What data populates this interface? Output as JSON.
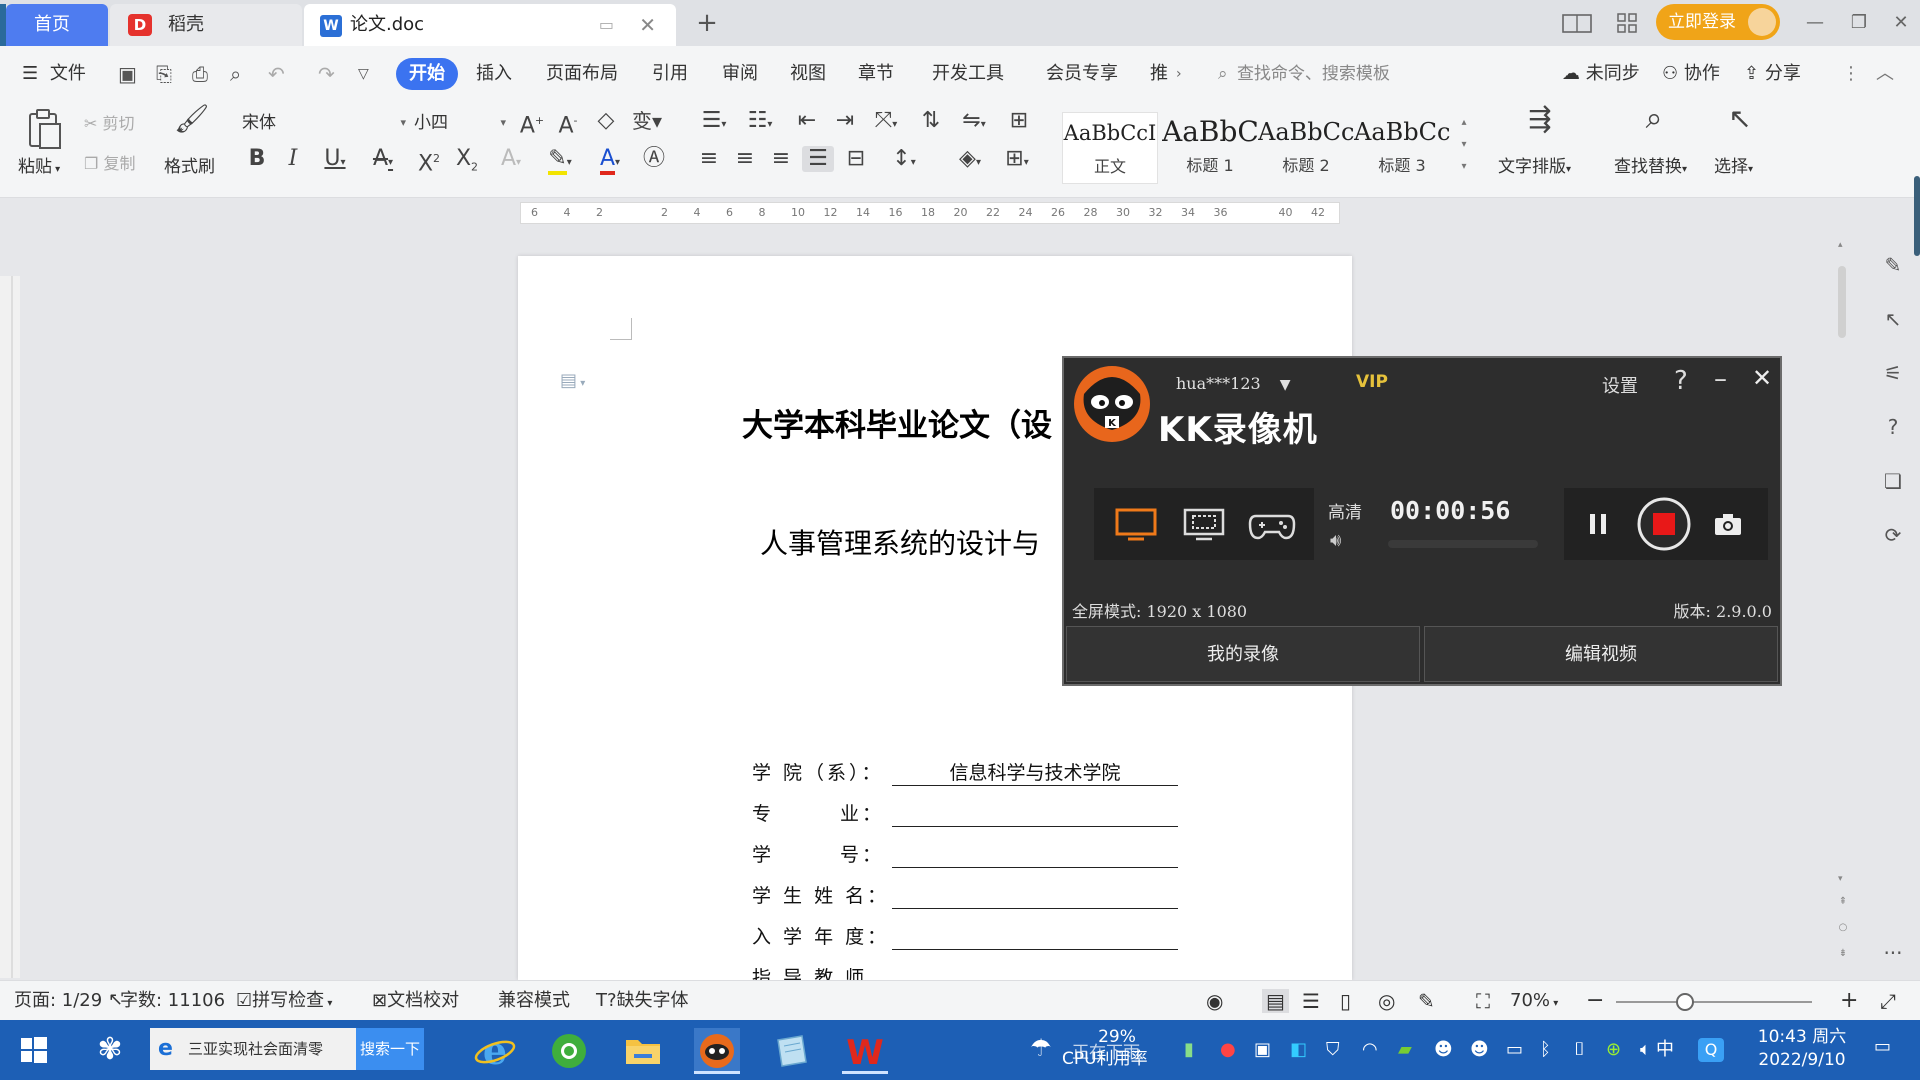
{
  "tabs": {
    "home": "首页",
    "daoke": "稻壳",
    "doc": "论文.doc"
  },
  "header": {
    "login": "立即登录"
  },
  "menu": {
    "file": "文件",
    "items": [
      "开始",
      "插入",
      "页面布局",
      "引用",
      "审阅",
      "视图",
      "章节",
      "开发工具",
      "会员专享",
      "推"
    ],
    "search_placeholder": "查找命令、搜索模板",
    "unsynced": "未同步",
    "collab": "协作",
    "share": "分享"
  },
  "ribbon": {
    "paste": "粘贴",
    "cut": "剪切",
    "copy": "复制",
    "format_painter": "格式刷",
    "font_name": "宋体",
    "font_size": "小四",
    "styles": [
      {
        "preview": "AaBbCcI",
        "label": "正文"
      },
      {
        "preview": "AaBbC",
        "label": "标题 1"
      },
      {
        "preview": "AaBbCc",
        "label": "标题 2"
      },
      {
        "preview": "AaBbCc",
        "label": "标题 3"
      }
    ],
    "text_layout": "文字排版",
    "find_replace": "查找替换",
    "select": "选择"
  },
  "ruler": {
    "ticks": [
      "6",
      "4",
      "2",
      "",
      "2",
      "4",
      "6",
      "8",
      "10",
      "12",
      "14",
      "16",
      "18",
      "20",
      "22",
      "24",
      "26",
      "28",
      "30",
      "32",
      "34",
      "36",
      "",
      "40",
      "42"
    ]
  },
  "document": {
    "title": "大学本科毕业论文（设",
    "subtitle": "人事管理系统的设计与",
    "form": [
      {
        "label": "学 院（系）：",
        "value": "信息科学与技术学院"
      },
      {
        "label": "专　　　业：",
        "value": ""
      },
      {
        "label": "学　　　号：",
        "value": ""
      },
      {
        "label": "学 生 姓 名：",
        "value": ""
      },
      {
        "label": "入 学 年 度：",
        "value": ""
      },
      {
        "label": "指 导 教 师",
        "value": ""
      }
    ]
  },
  "status": {
    "page": "页面: 1/29",
    "words": "字数: 11106",
    "spell": "拼写检查",
    "proof": "文档校对",
    "compat": "兼容模式",
    "missing_font": "缺失字体",
    "zoom": "70%"
  },
  "recorder": {
    "user": "hua***123",
    "vip": "VIP",
    "settings": "设置",
    "help": "?",
    "app_name": "KK录像机",
    "quality": "高清",
    "time": "00:00:56",
    "fullscreen_mode": "全屏模式: 1920 x 1080",
    "version": "版本: 2.9.0.0",
    "my_recordings": "我的录像",
    "edit_video": "编辑视频"
  },
  "taskbar": {
    "search_text": "三亚实现社会面清零",
    "search_button": "搜索一下",
    "cpu_percent": "29%",
    "cpu_label": "CPU利用率",
    "weather": "正在下雨",
    "ime": "中",
    "time": "10:43 周六",
    "date": "2022/9/10"
  },
  "colors": {
    "accent": "#3b73f0",
    "login": "#f0a418",
    "taskbar": "#1d5fb5",
    "record": "#e81818"
  }
}
